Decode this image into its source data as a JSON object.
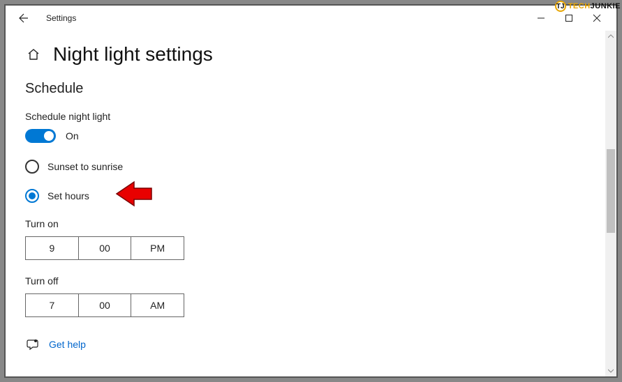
{
  "window": {
    "title": "Settings"
  },
  "page": {
    "heading": "Night light settings",
    "section_heading": "Schedule"
  },
  "schedule": {
    "toggle_label": "Schedule night light",
    "toggle_state": "On",
    "radio": {
      "sunset": "Sunset to sunrise",
      "set_hours": "Set hours"
    },
    "turn_on": {
      "label": "Turn on",
      "hour": "9",
      "minute": "00",
      "ampm": "PM"
    },
    "turn_off": {
      "label": "Turn off",
      "hour": "7",
      "minute": "00",
      "ampm": "AM"
    }
  },
  "help": {
    "link": "Get help"
  },
  "watermark": {
    "badge": "TJ",
    "part1": "TECH",
    "part2": "JUNKIE"
  }
}
